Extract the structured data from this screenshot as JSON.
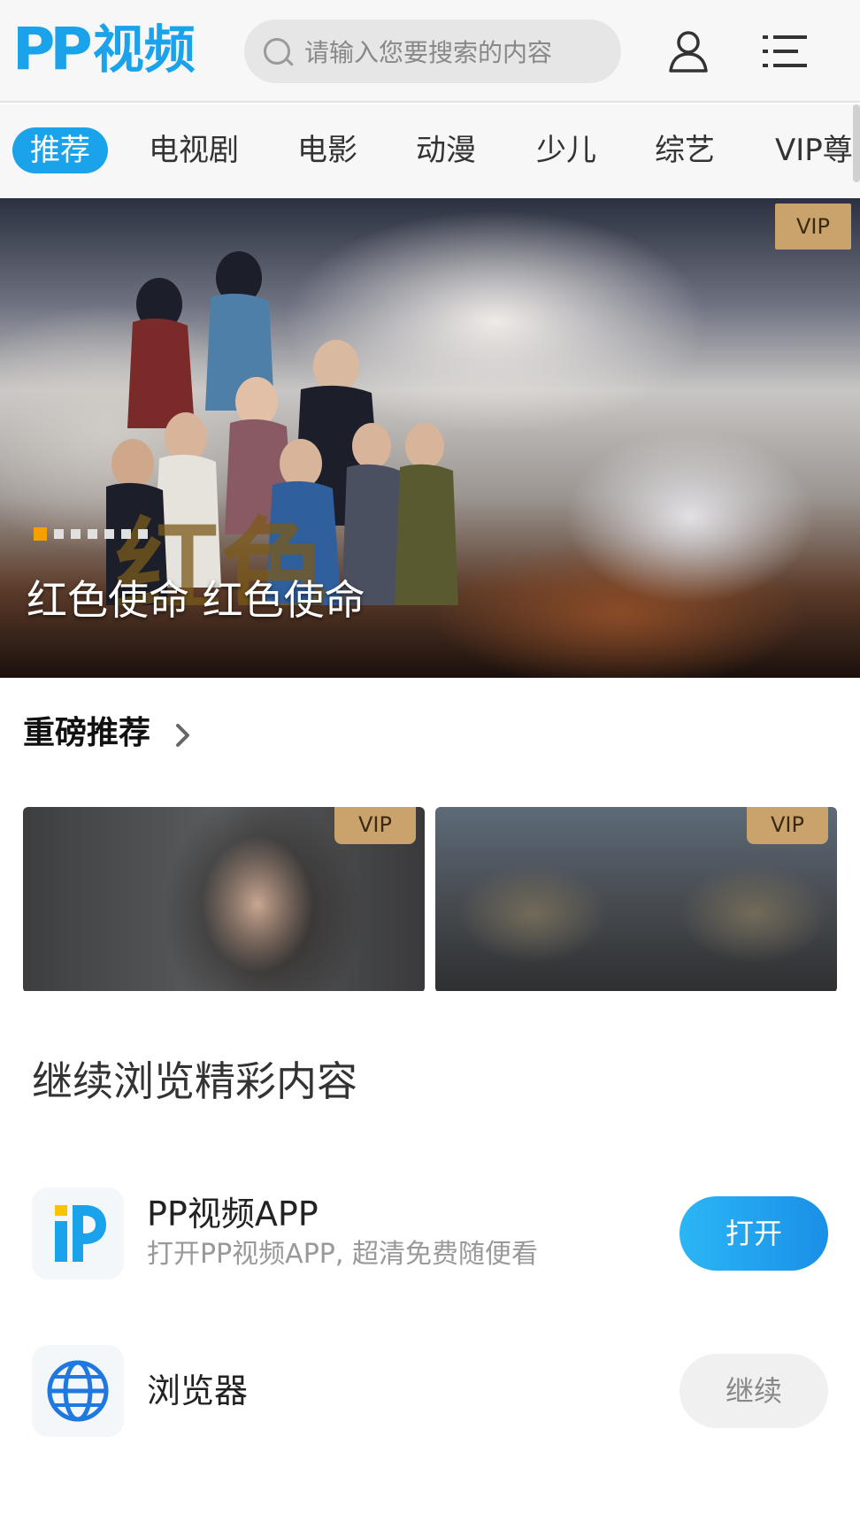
{
  "header": {
    "logo_mark": "PP",
    "logo_text": "视频",
    "search_placeholder": "请输入您要搜索的内容",
    "brand_color": "#1aa3ea"
  },
  "tabs": [
    {
      "label": "推荐",
      "active": true
    },
    {
      "label": "电视剧",
      "active": false
    },
    {
      "label": "电影",
      "active": false
    },
    {
      "label": "动漫",
      "active": false
    },
    {
      "label": "少儿",
      "active": false
    },
    {
      "label": "综艺",
      "active": false
    },
    {
      "label": "VIP尊享",
      "active": false
    }
  ],
  "banner": {
    "title": "红色使命 红色使命",
    "badge": "VIP",
    "slide_count": 7,
    "active_slide": 1
  },
  "featured": {
    "title": "重磅推荐",
    "cards": [
      {
        "badge": "VIP"
      },
      {
        "badge": "VIP"
      }
    ]
  },
  "sheet": {
    "title": "继续浏览精彩内容",
    "options": [
      {
        "name": "PP视频APP",
        "description": "打开PP视频APP, 超清免费随便看",
        "button": "打开",
        "icon": "pp-app-icon"
      },
      {
        "name": "浏览器",
        "description": "",
        "button": "继续",
        "icon": "globe-icon"
      }
    ]
  }
}
